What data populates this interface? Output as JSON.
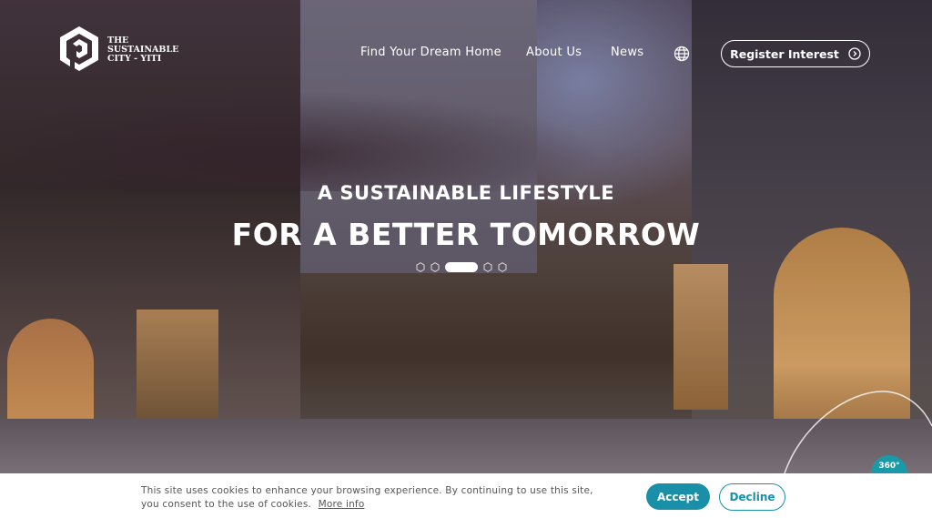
{
  "logo": {
    "line1": "THE",
    "line2": "SUSTAINABLE",
    "line3": "CITY - YITI"
  },
  "nav": {
    "items": [
      {
        "label": "Find Your Dream Home"
      },
      {
        "label": "About Us"
      },
      {
        "label": "News"
      }
    ],
    "language_icon": "globe-icon",
    "register_label": "Register Interest",
    "register_icon": "arrow-circle-right-icon"
  },
  "hero": {
    "subtitle": "A SUSTAINABLE LIFESTYLE",
    "title": "FOR A BETTER TOMORROW",
    "slides_total": 5,
    "active_slide": 3
  },
  "badge_360": "360°",
  "cookie": {
    "text": "This site uses cookies to enhance your browsing experience. By continuing to use this site, you consent to the use of cookies.",
    "more_info": "More info",
    "accept": "Accept",
    "decline": "Decline"
  },
  "colors": {
    "accent": "#1a8fa8"
  }
}
